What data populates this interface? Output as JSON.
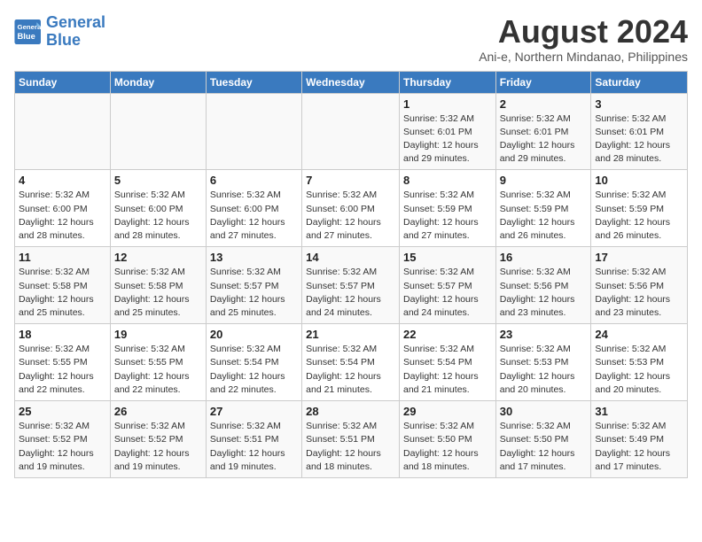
{
  "logo": {
    "line1": "General",
    "line2": "Blue"
  },
  "title": "August 2024",
  "subtitle": "Ani-e, Northern Mindanao, Philippines",
  "headers": [
    "Sunday",
    "Monday",
    "Tuesday",
    "Wednesday",
    "Thursday",
    "Friday",
    "Saturday"
  ],
  "weeks": [
    [
      {
        "day": "",
        "info": ""
      },
      {
        "day": "",
        "info": ""
      },
      {
        "day": "",
        "info": ""
      },
      {
        "day": "",
        "info": ""
      },
      {
        "day": "1",
        "info": "Sunrise: 5:32 AM\nSunset: 6:01 PM\nDaylight: 12 hours\nand 29 minutes."
      },
      {
        "day": "2",
        "info": "Sunrise: 5:32 AM\nSunset: 6:01 PM\nDaylight: 12 hours\nand 29 minutes."
      },
      {
        "day": "3",
        "info": "Sunrise: 5:32 AM\nSunset: 6:01 PM\nDaylight: 12 hours\nand 28 minutes."
      }
    ],
    [
      {
        "day": "4",
        "info": "Sunrise: 5:32 AM\nSunset: 6:00 PM\nDaylight: 12 hours\nand 28 minutes."
      },
      {
        "day": "5",
        "info": "Sunrise: 5:32 AM\nSunset: 6:00 PM\nDaylight: 12 hours\nand 28 minutes."
      },
      {
        "day": "6",
        "info": "Sunrise: 5:32 AM\nSunset: 6:00 PM\nDaylight: 12 hours\nand 27 minutes."
      },
      {
        "day": "7",
        "info": "Sunrise: 5:32 AM\nSunset: 6:00 PM\nDaylight: 12 hours\nand 27 minutes."
      },
      {
        "day": "8",
        "info": "Sunrise: 5:32 AM\nSunset: 5:59 PM\nDaylight: 12 hours\nand 27 minutes."
      },
      {
        "day": "9",
        "info": "Sunrise: 5:32 AM\nSunset: 5:59 PM\nDaylight: 12 hours\nand 26 minutes."
      },
      {
        "day": "10",
        "info": "Sunrise: 5:32 AM\nSunset: 5:59 PM\nDaylight: 12 hours\nand 26 minutes."
      }
    ],
    [
      {
        "day": "11",
        "info": "Sunrise: 5:32 AM\nSunset: 5:58 PM\nDaylight: 12 hours\nand 25 minutes."
      },
      {
        "day": "12",
        "info": "Sunrise: 5:32 AM\nSunset: 5:58 PM\nDaylight: 12 hours\nand 25 minutes."
      },
      {
        "day": "13",
        "info": "Sunrise: 5:32 AM\nSunset: 5:57 PM\nDaylight: 12 hours\nand 25 minutes."
      },
      {
        "day": "14",
        "info": "Sunrise: 5:32 AM\nSunset: 5:57 PM\nDaylight: 12 hours\nand 24 minutes."
      },
      {
        "day": "15",
        "info": "Sunrise: 5:32 AM\nSunset: 5:57 PM\nDaylight: 12 hours\nand 24 minutes."
      },
      {
        "day": "16",
        "info": "Sunrise: 5:32 AM\nSunset: 5:56 PM\nDaylight: 12 hours\nand 23 minutes."
      },
      {
        "day": "17",
        "info": "Sunrise: 5:32 AM\nSunset: 5:56 PM\nDaylight: 12 hours\nand 23 minutes."
      }
    ],
    [
      {
        "day": "18",
        "info": "Sunrise: 5:32 AM\nSunset: 5:55 PM\nDaylight: 12 hours\nand 22 minutes."
      },
      {
        "day": "19",
        "info": "Sunrise: 5:32 AM\nSunset: 5:55 PM\nDaylight: 12 hours\nand 22 minutes."
      },
      {
        "day": "20",
        "info": "Sunrise: 5:32 AM\nSunset: 5:54 PM\nDaylight: 12 hours\nand 22 minutes."
      },
      {
        "day": "21",
        "info": "Sunrise: 5:32 AM\nSunset: 5:54 PM\nDaylight: 12 hours\nand 21 minutes."
      },
      {
        "day": "22",
        "info": "Sunrise: 5:32 AM\nSunset: 5:54 PM\nDaylight: 12 hours\nand 21 minutes."
      },
      {
        "day": "23",
        "info": "Sunrise: 5:32 AM\nSunset: 5:53 PM\nDaylight: 12 hours\nand 20 minutes."
      },
      {
        "day": "24",
        "info": "Sunrise: 5:32 AM\nSunset: 5:53 PM\nDaylight: 12 hours\nand 20 minutes."
      }
    ],
    [
      {
        "day": "25",
        "info": "Sunrise: 5:32 AM\nSunset: 5:52 PM\nDaylight: 12 hours\nand 19 minutes."
      },
      {
        "day": "26",
        "info": "Sunrise: 5:32 AM\nSunset: 5:52 PM\nDaylight: 12 hours\nand 19 minutes."
      },
      {
        "day": "27",
        "info": "Sunrise: 5:32 AM\nSunset: 5:51 PM\nDaylight: 12 hours\nand 19 minutes."
      },
      {
        "day": "28",
        "info": "Sunrise: 5:32 AM\nSunset: 5:51 PM\nDaylight: 12 hours\nand 18 minutes."
      },
      {
        "day": "29",
        "info": "Sunrise: 5:32 AM\nSunset: 5:50 PM\nDaylight: 12 hours\nand 18 minutes."
      },
      {
        "day": "30",
        "info": "Sunrise: 5:32 AM\nSunset: 5:50 PM\nDaylight: 12 hours\nand 17 minutes."
      },
      {
        "day": "31",
        "info": "Sunrise: 5:32 AM\nSunset: 5:49 PM\nDaylight: 12 hours\nand 17 minutes."
      }
    ]
  ]
}
